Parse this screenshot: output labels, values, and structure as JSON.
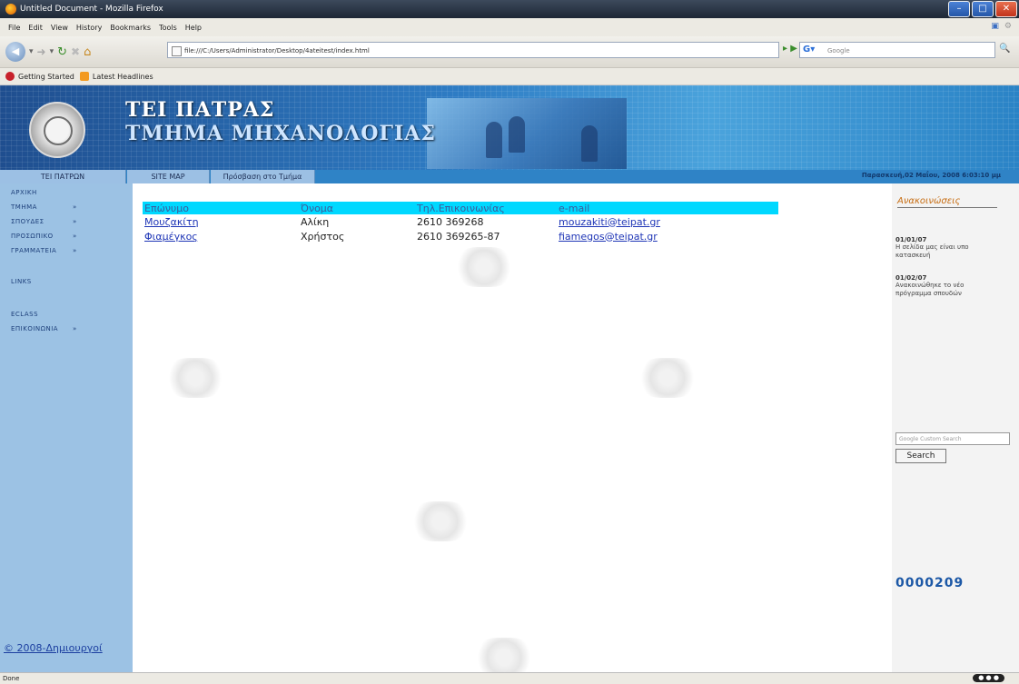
{
  "window": {
    "title": "Untitled Document - Mozilla Firefox"
  },
  "menu": [
    "File",
    "Edit",
    "View",
    "History",
    "Bookmarks",
    "Tools",
    "Help"
  ],
  "nav": {
    "url": "file:///C:/Users/Administrator/Desktop/4ateitest/index.html",
    "search_placeholder": "Google"
  },
  "bookmarks": [
    "Getting Started",
    "Latest Headlines"
  ],
  "header": {
    "org_line1": "ΤΕΙ ΠΑΤΡΑΣ",
    "org_line2": "ΤΜΗΜΑ ΜΗΧΑΝΟΛΟΓΙΑΣ"
  },
  "topnav": {
    "items": [
      "ΤΕΙ ΠΑΤΡΩΝ",
      "SITE MAP",
      "Πρόσβαση στο Τμήμα"
    ],
    "datetime": "Παρασκευή,02 Μαΐου, 2008 6:03:10 μμ"
  },
  "sidebar": {
    "items": [
      "ΑΡΧΙΚΗ",
      "ΤΜΗΜΑ",
      "ΣΠΟΥΔΕΣ",
      "ΠΡΟΣΩΠΙΚΟ",
      "ΓΡΑΜΜΑΤΕΙΑ",
      "LINKS",
      "ECLASS",
      "ΕΠΙΚΟΙΝΩΝΙΑ"
    ],
    "footer": "© 2008-Δημιουργοί"
  },
  "table": {
    "headers": [
      "Επώνυμο",
      "Όνομα",
      "Τηλ.Επικοινωνίας",
      "e-mail"
    ],
    "rows": [
      [
        "Μουζακίτη",
        "Αλίκη",
        "2610 369268",
        "mouzakiti@teipat.gr"
      ],
      [
        "Φιαμέγκος",
        "Χρήστος",
        "2610 369265-87",
        "fiamegos@teipat.gr"
      ]
    ]
  },
  "right": {
    "heading": "Ανακοινώσεις",
    "news": [
      {
        "date": "01/01/07",
        "text": "Η σελίδα μας είναι υπο κατασκευή"
      },
      {
        "date": "01/02/07",
        "text": "Ανακοινώθηκε το νέο πρόγραμμα σπουδών"
      }
    ],
    "search_placeholder": "Google Custom Search",
    "search_button": "Search",
    "counter": "0000209"
  },
  "status": {
    "text": "Done"
  }
}
